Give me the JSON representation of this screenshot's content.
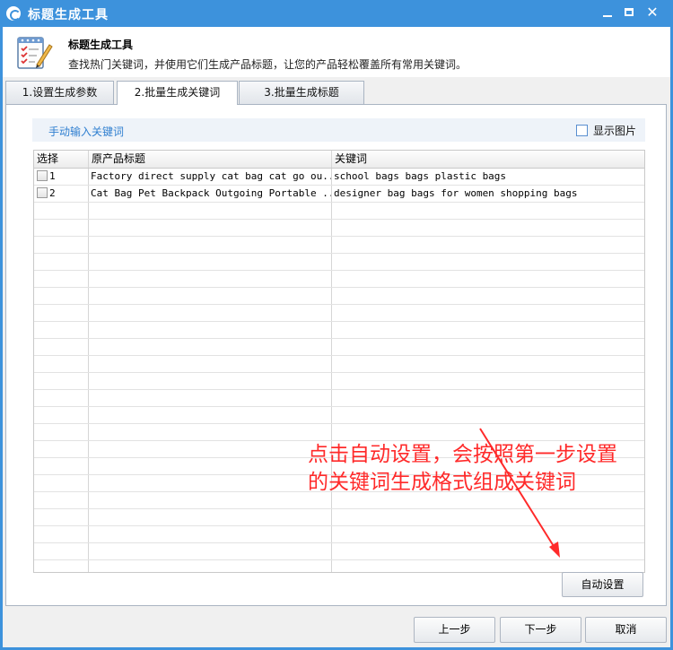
{
  "window": {
    "title": "标题生成工具"
  },
  "header": {
    "title": "标题生成工具",
    "description": "查找热门关键词，并使用它们生成产品标题，让您的产品轻松覆盖所有常用关键词。"
  },
  "tabs": [
    {
      "label": "1.设置生成参数"
    },
    {
      "label": "2.批量生成关键词",
      "active": true
    },
    {
      "label": "3.批量生成标题"
    }
  ],
  "toolbar": {
    "manual_input": "手动输入关键词",
    "show_images": "显示图片"
  },
  "grid": {
    "columns": [
      "选择",
      "原产品标题",
      "关键词"
    ],
    "rows": [
      {
        "index": "1",
        "title": "Factory direct supply cat bag cat go ou...",
        "keywords": "school bags bags plastic bags"
      },
      {
        "index": "2",
        "title": "Cat Bag Pet Backpack Outgoing Portable ...",
        "keywords": "designer bag bags for women shopping bags"
      }
    ]
  },
  "buttons": {
    "auto_setup": "自动设置",
    "prev": "上一步",
    "next": "下一步",
    "cancel": "取消"
  },
  "annotation": {
    "line1": "点击自动设置，会按照第一步设置",
    "line2": "的关键词生成格式组成关键词",
    "color": "#ff2a2a"
  },
  "colors": {
    "titlebar": "#3d92dc",
    "link": "#2f7fd0"
  }
}
